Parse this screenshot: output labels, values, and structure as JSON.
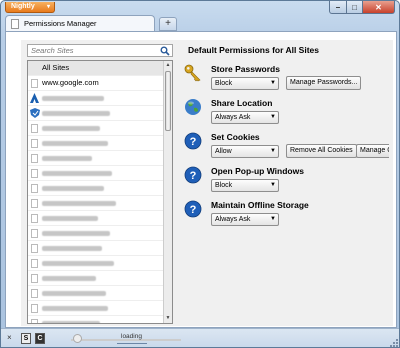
{
  "app": {
    "menu_button": "Nightly",
    "menu_caret": "▾"
  },
  "window_controls": {
    "minimize": "–",
    "maximize": "□",
    "close": "✕"
  },
  "tab": {
    "title": "Permissions Manager",
    "close": "×",
    "new_tab": "+"
  },
  "search": {
    "placeholder": "Search Sites"
  },
  "sites": {
    "all_sites": "All Sites",
    "first_site": "www.google.com",
    "blurred_rows": 14
  },
  "permissions": {
    "heading": "Default Permissions for All Sites",
    "store_passwords": {
      "label": "Store Passwords",
      "value": "Block",
      "button": "Manage Passwords..."
    },
    "share_location": {
      "label": "Share Location",
      "value": "Always Ask"
    },
    "set_cookies": {
      "label": "Set Cookies",
      "value": "Allow",
      "button1": "Remove All Cookies",
      "button2": "Manage C"
    },
    "popups": {
      "label": "Open Pop-up Windows",
      "value": "Block"
    },
    "offline_storage": {
      "label": "Maintain Offline Storage",
      "value": "Always Ask"
    }
  },
  "statusbar": {
    "close": "×",
    "loading": "loading"
  },
  "colors": {
    "accent_orange": "#e97b1c",
    "help_blue": "#1f5fb8",
    "frame": "#b7cde6"
  }
}
